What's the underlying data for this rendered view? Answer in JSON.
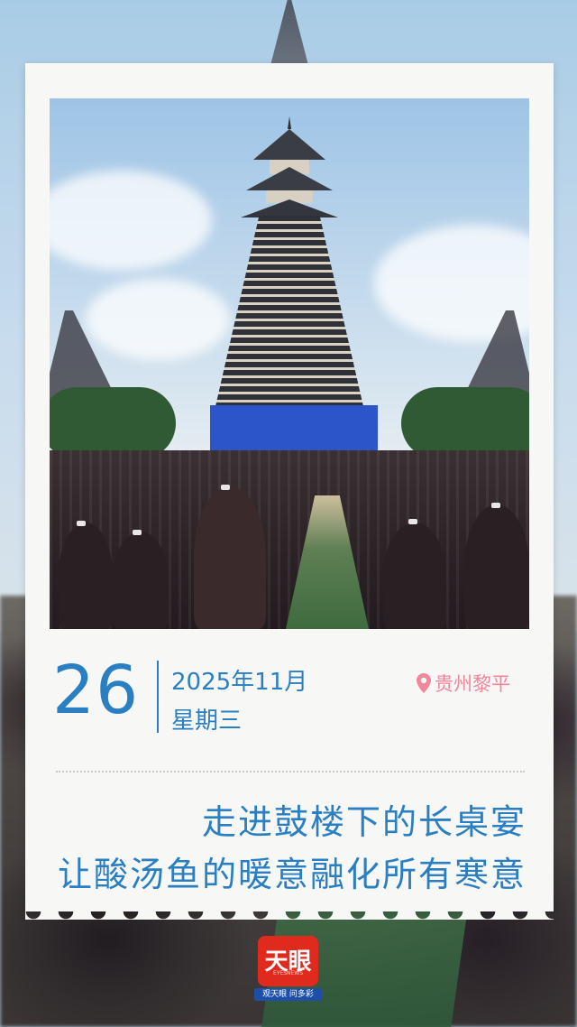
{
  "date": {
    "day": "26",
    "year_month": "2025年11月",
    "weekday": "星期三"
  },
  "location": {
    "text": "贵州黎平",
    "icon": "location-pin-icon"
  },
  "headline": {
    "line1": "走进鼓楼下的长桌宴",
    "line2": "让酸汤鱼的暖意融化所有寒意"
  },
  "logo": {
    "name": "天眼",
    "subtitle": "EYESNEWS",
    "slogan": "观天眼 问多彩"
  },
  "colors": {
    "accent": "#2a7fc3",
    "location": "#f0879a",
    "logo_red": "#e02a1e",
    "logo_blue": "#1e4fa8"
  }
}
